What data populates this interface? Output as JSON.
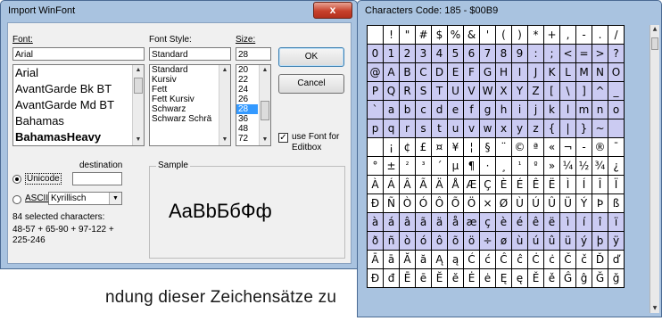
{
  "background_text": "ndung dieser Zeichensätze zu",
  "import_dialog": {
    "title": "Import WinFont",
    "close_label": "x",
    "font_label": "Font:",
    "font_value": "Arial",
    "fonts": [
      "Arial",
      "AvantGarde Bk BT",
      "AvantGarde Md BT",
      "Bahamas",
      "BahamasHeavy"
    ],
    "style_label": "Font Style:",
    "style_value": "Standard",
    "styles": [
      "Standard",
      "Kursiv",
      "Fett",
      "Fett Kursiv",
      "Schwarz",
      "Schwarz Schrä"
    ],
    "size_label": "Size:",
    "size_value": "28",
    "sizes": [
      "20",
      "22",
      "24",
      "26",
      "28",
      "36",
      "48",
      "72"
    ],
    "ok_label": "OK",
    "cancel_label": "Cancel",
    "use_font_checked": "✓",
    "use_font_label_1": "use Font for",
    "use_font_label_2": "Editbox",
    "destination_label": "destination",
    "unicode_label": "Unicode",
    "ascii_label": "ASCII",
    "ascii_combo_value": "Kyrillisch",
    "selected_count": "84 selected characters:",
    "selected_ranges_1": "48-57 + 65-90 + 97-122 +",
    "selected_ranges_2": "225-246",
    "sample_label": "Sample",
    "sample_text": "AaBbБбФф"
  },
  "characters_window": {
    "title": "Characters  Code: 185 - $00B9",
    "rows": [
      [
        "",
        "!",
        "\"",
        "#",
        "$",
        "%",
        "&",
        "'",
        "(",
        ")",
        "*",
        "+",
        ",",
        "-",
        ".",
        "/"
      ],
      [
        "0",
        "1",
        "2",
        "3",
        "4",
        "5",
        "6",
        "7",
        "8",
        "9",
        ":",
        ";",
        "<",
        "=",
        ">",
        "?"
      ],
      [
        "@",
        "A",
        "B",
        "C",
        "D",
        "E",
        "F",
        "G",
        "H",
        "I",
        "J",
        "K",
        "L",
        "M",
        "N",
        "O"
      ],
      [
        "P",
        "Q",
        "R",
        "S",
        "T",
        "U",
        "V",
        "W",
        "X",
        "Y",
        "Z",
        "[",
        "\\",
        "]",
        "^",
        "_"
      ],
      [
        "`",
        "a",
        "b",
        "c",
        "d",
        "e",
        "f",
        "g",
        "h",
        "i",
        "j",
        "k",
        "l",
        "m",
        "n",
        "o"
      ],
      [
        "p",
        "q",
        "r",
        "s",
        "t",
        "u",
        "v",
        "w",
        "x",
        "y",
        "z",
        "{",
        "|",
        "}",
        "~",
        ""
      ],
      [
        "",
        "¡",
        "¢",
        "£",
        "¤",
        "¥",
        "¦",
        "§",
        "¨",
        "©",
        "ª",
        "«",
        "¬",
        "-",
        "®",
        "¯"
      ],
      [
        "°",
        "±",
        "²",
        "³",
        "´",
        "µ",
        "¶",
        "·",
        "¸",
        "¹",
        "º",
        "»",
        "¼",
        "½",
        "¾",
        "¿"
      ],
      [
        "À",
        "Á",
        "Â",
        "Ã",
        "Ä",
        "Å",
        "Æ",
        "Ç",
        "È",
        "É",
        "Ê",
        "Ë",
        "Ì",
        "Í",
        "Î",
        "Ï"
      ],
      [
        "Ð",
        "Ñ",
        "Ò",
        "Ó",
        "Ô",
        "Õ",
        "Ö",
        "×",
        "Ø",
        "Ù",
        "Ú",
        "Û",
        "Ü",
        "Ý",
        "Þ",
        "ß"
      ],
      [
        "à",
        "á",
        "â",
        "ã",
        "ä",
        "å",
        "æ",
        "ç",
        "è",
        "é",
        "ê",
        "ë",
        "ì",
        "í",
        "î",
        "ï"
      ],
      [
        "ð",
        "ñ",
        "ò",
        "ó",
        "ô",
        "õ",
        "ö",
        "÷",
        "ø",
        "ù",
        "ú",
        "û",
        "ü",
        "ý",
        "þ",
        "ÿ"
      ],
      [
        "Ā",
        "ā",
        "Ă",
        "ă",
        "Ą",
        "ą",
        "Ć",
        "ć",
        "Ĉ",
        "ĉ",
        "Ċ",
        "ċ",
        "Č",
        "č",
        "Ď",
        "ď"
      ],
      [
        "Đ",
        "đ",
        "Ē",
        "ē",
        "Ĕ",
        "ĕ",
        "Ė",
        "ė",
        "Ę",
        "ę",
        "Ě",
        "ě",
        "Ĝ",
        "ĝ",
        "Ğ",
        "ğ"
      ]
    ],
    "highlighted_rows": [
      1,
      2,
      3,
      4,
      5,
      10,
      11
    ],
    "colors": {
      "highlight": "#cbcbf2",
      "plain": "#ffffff",
      "frame": "#a9c3e0"
    }
  }
}
